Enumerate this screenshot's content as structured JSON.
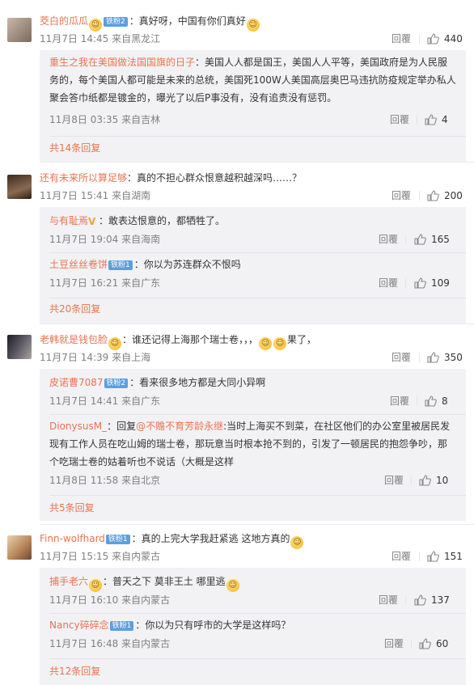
{
  "actions": {
    "reply": "回覆",
    "reply_simplified": "回复"
  },
  "comments": [
    {
      "user": "茭白的瓜瓜",
      "badge": "铁粉2",
      "text": "：真好呀，中国有你们真好",
      "meta": "11月7日 14:45 来自黑龙江",
      "likes": "440",
      "replies": [
        {
          "user": "重生之我在美国做法国国旗的日子",
          "text": "：美国人人都是国王，美国人人平等，美国政府是为人民服务的，每个美国人都可能是未来的总统，美国死100W人美国高层奥巴马违抗防疫规定举办私人聚会答巾纸都是镀金的，曝光了以后P事没有，没有追责没有惩罚。",
          "meta": "11月8日 03:35 来自吉林",
          "likes": "4"
        }
      ],
      "more": "共14条回复"
    },
    {
      "user": "还有未来所以算足够",
      "text": "：真的不担心群众恨意越积越深吗……？",
      "meta": "11月7日 15:41 来自湖南",
      "likes": "200",
      "replies": [
        {
          "user": "与有耻焉",
          "text": "：敢表达恨意的，都牺牲了。",
          "meta": "11月7日 19:04 来自海南",
          "likes": "165"
        },
        {
          "user": "土豆丝丝卷饼",
          "badge": "铁粉1",
          "text": "：你以为苏连群众不恨吗",
          "meta": "11月7日 16:21 来自广东",
          "likes": "109"
        }
      ],
      "more": "共20条回复"
    },
    {
      "user": "老韩就是钱包脸",
      "text": "：谁还记得上海那个瑞士卷，，，",
      "text_tail": "果了，",
      "meta": "11月7日 14:39 来自上海",
      "likes": "350",
      "replies": [
        {
          "user": "皮诺曹7087",
          "badge": "铁粉2",
          "text": "：看来很多地方都是大同小异啊",
          "meta": "11月7日 14:41 来自广东",
          "likes": "8"
        },
        {
          "user": "DionysusM_",
          "text_prefix": "：回复",
          "mention": "@不赡不育芳龄永继",
          "text": ":当时上海买不到菜，在社区他们的办公室里被居民发现有工作人员在吃山姆的瑞士卷，那玩意当时根本抢不到的，引发了一顿居民的抱怨争吵，那个吃瑞士卷的姑着听也不说话（大概是这样",
          "meta": "11月8日 11:58 来自北京",
          "likes": "10"
        }
      ],
      "more": "共5条回复"
    },
    {
      "user": "Finn-wolfhard",
      "badge": "铁粉1",
      "text": "：真的上完大学我赶紧逃 这地方真的",
      "meta": "11月7日 15:15 来自内蒙古",
      "likes": "151",
      "replies": [
        {
          "user": "捕手老六",
          "text": "：普天之下 莫非王土 哪里逃",
          "meta": "11月7日 16:10 来自内蒙古",
          "likes": "137"
        },
        {
          "user": "Nancy碎碎念",
          "badge": "铁粉1",
          "text": "：你以为只有呼市的大学是这样吗？",
          "meta": "11月7日 16:48 来自内蒙古",
          "likes": "60"
        }
      ],
      "more": "共12条回复"
    }
  ],
  "icons": {
    "like": "thumbs-up-icon",
    "emoji": "emoji-face-icon",
    "vip": "vip-v-icon"
  },
  "colors": {
    "username": "#eb7350",
    "meta": "#808080",
    "reply_bg": "#f2f2f5",
    "badge": "#5d9fde"
  }
}
